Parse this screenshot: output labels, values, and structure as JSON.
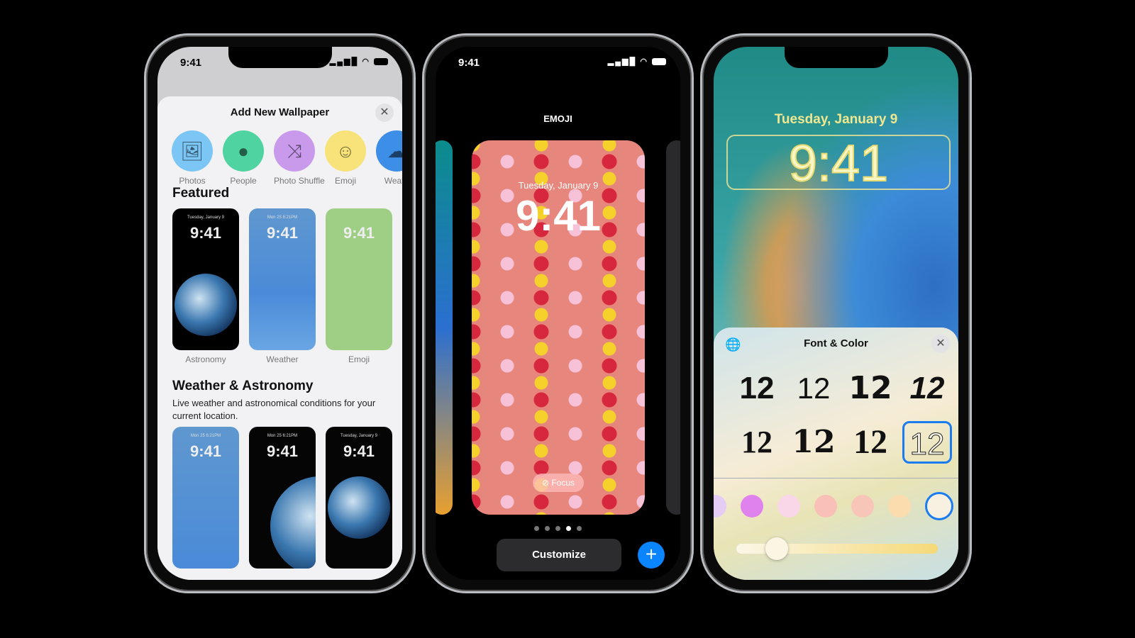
{
  "status": {
    "time": "9:41",
    "signal": "▂▄▆█",
    "wifi": "◠"
  },
  "add_wallpaper": {
    "title": "Add New Wallpaper",
    "close": "✕",
    "categories": [
      {
        "label": "Photos",
        "icon": "photos-icon",
        "glyph": "🖼",
        "color": "#7cc6f5"
      },
      {
        "label": "People",
        "icon": "person-icon",
        "glyph": "●",
        "color": "#4fd3a0"
      },
      {
        "label": "Photo Shuffle",
        "icon": "shuffle-icon",
        "glyph": "⤨",
        "color": "#c99aec"
      },
      {
        "label": "Emoji",
        "icon": "smiley-icon",
        "glyph": "☺",
        "color": "#f7e37a"
      },
      {
        "label": "Weath",
        "icon": "cloud-sun-icon",
        "glyph": "☁",
        "color": "#3d8ee6"
      }
    ],
    "featured_title": "Featured",
    "featured": [
      {
        "label": "Astronomy",
        "time": "9:41",
        "sub": "Tuesday, January 9"
      },
      {
        "label": "Weather",
        "time": "9:41",
        "sub": "Mon 25  6:21PM"
      },
      {
        "label": "Emoji",
        "time": "9:41"
      }
    ],
    "section2_title": "Weather & Astronomy",
    "section2_desc": "Live weather and astronomical conditions for your current location.",
    "section2": [
      {
        "time": "9:41",
        "sub": "Mon 25  6:21PM"
      },
      {
        "time": "9:41",
        "sub": "Mon 25  6:21PM"
      },
      {
        "time": "9:41",
        "sub": "Tuesday, January 9"
      }
    ]
  },
  "emoji_screen": {
    "title": "EMOJI",
    "date": "Tuesday, January 9",
    "time": "9:41",
    "focus": "⊘ Focus",
    "page_count": 5,
    "active_page": 4,
    "customize": "Customize",
    "add": "+"
  },
  "lock_screen": {
    "date": "Tuesday, January 9",
    "time": "9:41"
  },
  "font_color": {
    "title": "Font & Color",
    "globe": "🌐",
    "close": "✕",
    "font_sample": "12",
    "selected_font": 8,
    "colors": [
      "#e4ccf5",
      "#df82ee",
      "#f9d7e8",
      "#f8c0b6",
      "#f8c6b8",
      "#fbdcae",
      "#f8f1e2"
    ],
    "selected_color": 7,
    "slider_value": 0.2,
    "accent": "#1b7cf0"
  }
}
